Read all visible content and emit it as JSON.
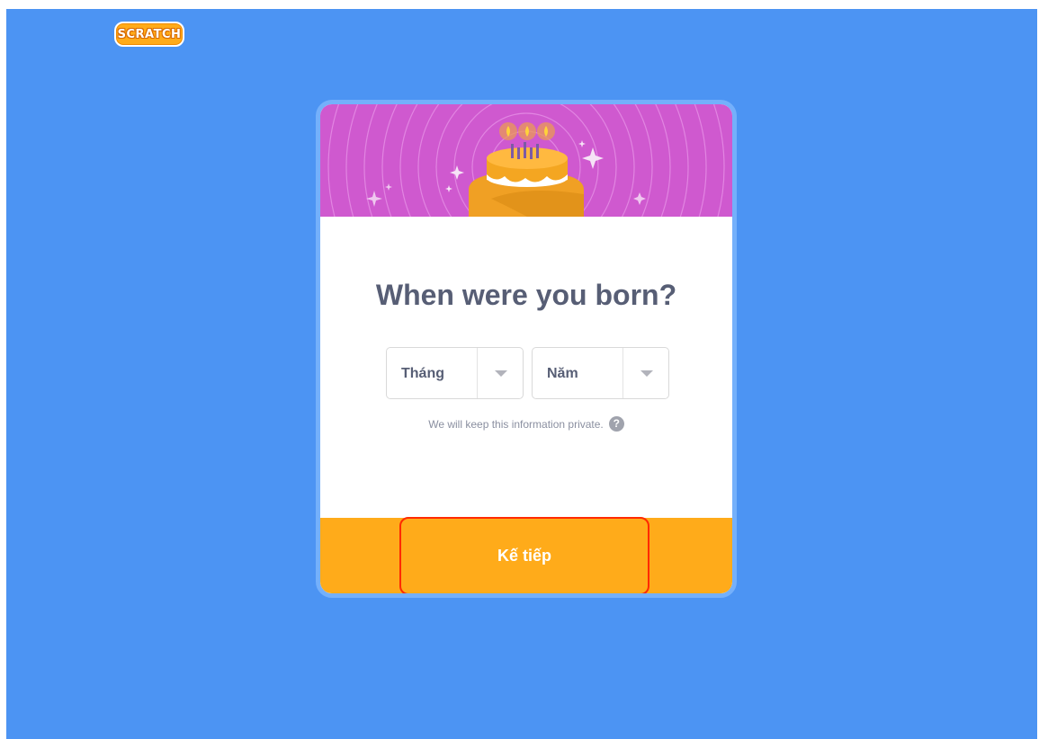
{
  "brand": {
    "logo_text": "SCRATCH"
  },
  "dialog": {
    "title": "When were you born?",
    "month_select": {
      "value": "Tháng"
    },
    "year_select": {
      "value": "Năm"
    },
    "privacy_text": "We will keep this information private.",
    "help_icon_glyph": "?",
    "next_button_label": "Kế tiếp"
  },
  "colors": {
    "background": "#4c94f3",
    "banner": "#cf59cf",
    "footer": "#ffab1a",
    "title_text": "#575e75",
    "highlight_border": "#ff2a00"
  },
  "icons": [
    "scratch-logo",
    "birthday-cake-illustration",
    "chevron-down-icon",
    "help-icon"
  ]
}
